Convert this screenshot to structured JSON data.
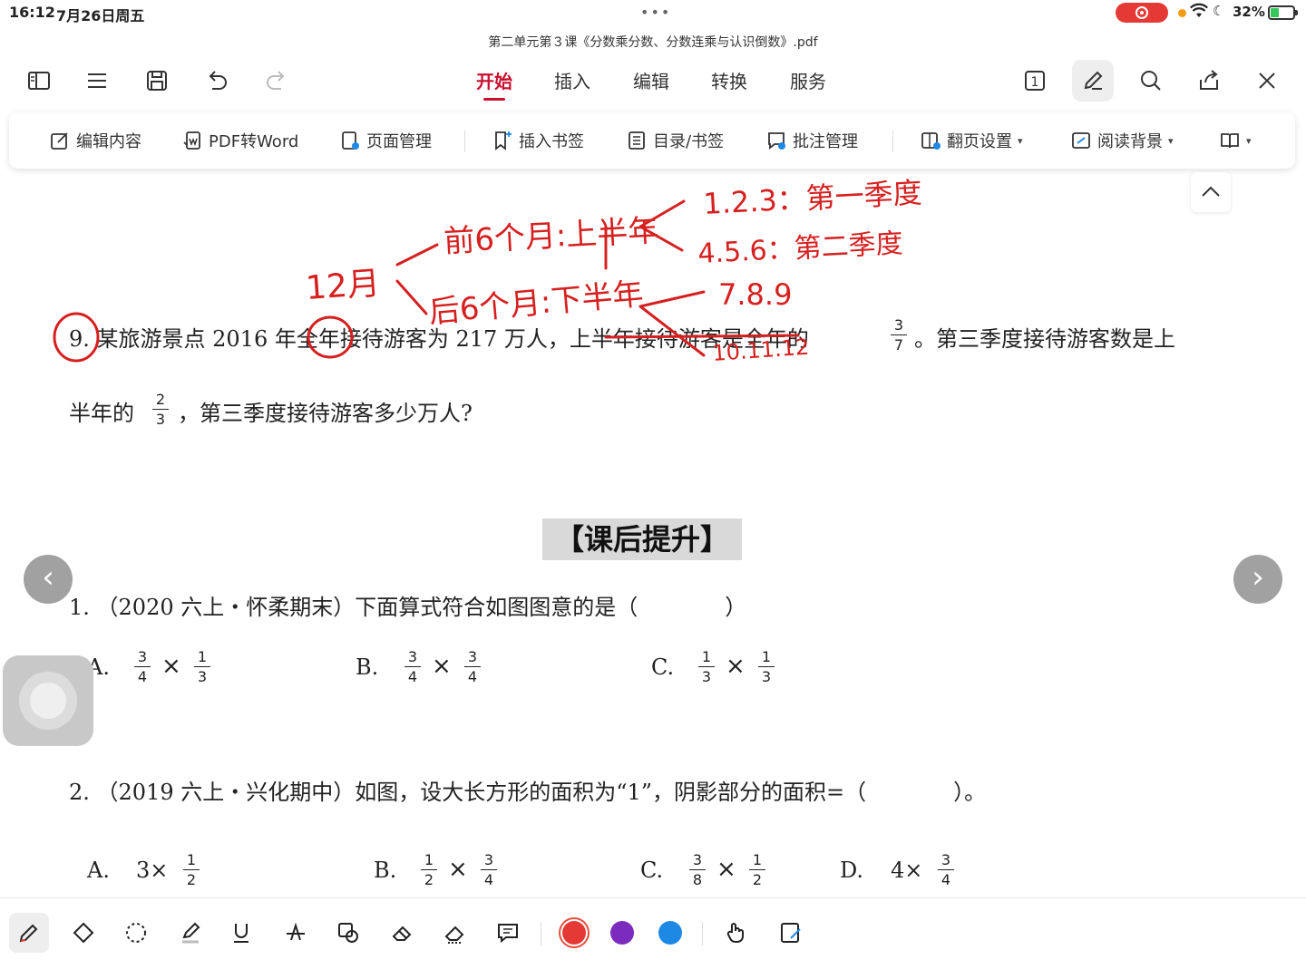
{
  "status_bar": {
    "time": "16:12",
    "date": "7月26日周五",
    "battery": "32%"
  },
  "document_title": "第二单元第３课《分数乘分数、分数连乘与认识倒数》.pdf",
  "top_menu": {
    "tabs": [
      "开始",
      "插入",
      "编辑",
      "转换",
      "服务"
    ],
    "active_tab": "开始",
    "page_indicator": "1"
  },
  "ribbon": {
    "edit_content": "编辑内容",
    "pdf_to_word": "PDF转Word",
    "page_manage": "页面管理",
    "insert_bookmark": "插入书签",
    "toc_bookmark": "目录/书签",
    "annotation_manage": "批注管理",
    "page_turn_settings": "翻页设置",
    "reading_background": "阅读背景"
  },
  "document": {
    "q9": {
      "line1_a": "9. 某旅游景点 2016 年全年接待游客为 217 万人，上半年接待游客是全年的",
      "line1_b": "。第三季度接待游客数是上",
      "line2_a": "半年的",
      "line2_b": "，第三季度接待游客多少万人?",
      "frac1": {
        "num": "3",
        "den": "7"
      },
      "frac2": {
        "num": "2",
        "den": "3"
      }
    },
    "section_title": "【课后提升】",
    "q1": {
      "stem": "1. （2020 六上・怀柔期末）下面算式符合如图图意的是（　　　　）",
      "options": [
        {
          "label": "A.",
          "a": {
            "num": "3",
            "den": "4"
          },
          "b": {
            "num": "1",
            "den": "3"
          }
        },
        {
          "label": "B.",
          "a": {
            "num": "3",
            "den": "4"
          },
          "b": {
            "num": "3",
            "den": "4"
          }
        },
        {
          "label": "C.",
          "a": {
            "num": "1",
            "den": "3"
          },
          "b": {
            "num": "1",
            "den": "3"
          }
        }
      ]
    },
    "q2": {
      "stem": "2. （2019 六上・兴化期中）如图，设大长方形的面积为“1”，阴影部分的面积=（　　　　）。",
      "options": [
        {
          "label": "A.",
          "prefix": "3×",
          "a": {
            "num": "1",
            "den": "2"
          }
        },
        {
          "label": "B.",
          "a": {
            "num": "1",
            "den": "2"
          },
          "b": {
            "num": "3",
            "den": "4"
          }
        },
        {
          "label": "C.",
          "a": {
            "num": "3",
            "den": "8"
          },
          "b": {
            "num": "1",
            "den": "2"
          }
        },
        {
          "label": "D.",
          "prefix": "4×",
          "a": {
            "num": "3",
            "den": "4"
          }
        }
      ]
    },
    "times_sign": "×"
  },
  "handwriting": {
    "whole_year": "12月",
    "first_half": "前6个月:上半年",
    "second_half": "后6个月:下半年",
    "q1": "1.2.3：第一季度",
    "q2": "4.5.6：第二季度",
    "q3": "7.8.9",
    "q4": "10.11.12",
    "ink_color": "#d62020"
  },
  "pen_colors": [
    "#e53935",
    "#7b2cbf",
    "#1e88e5"
  ]
}
